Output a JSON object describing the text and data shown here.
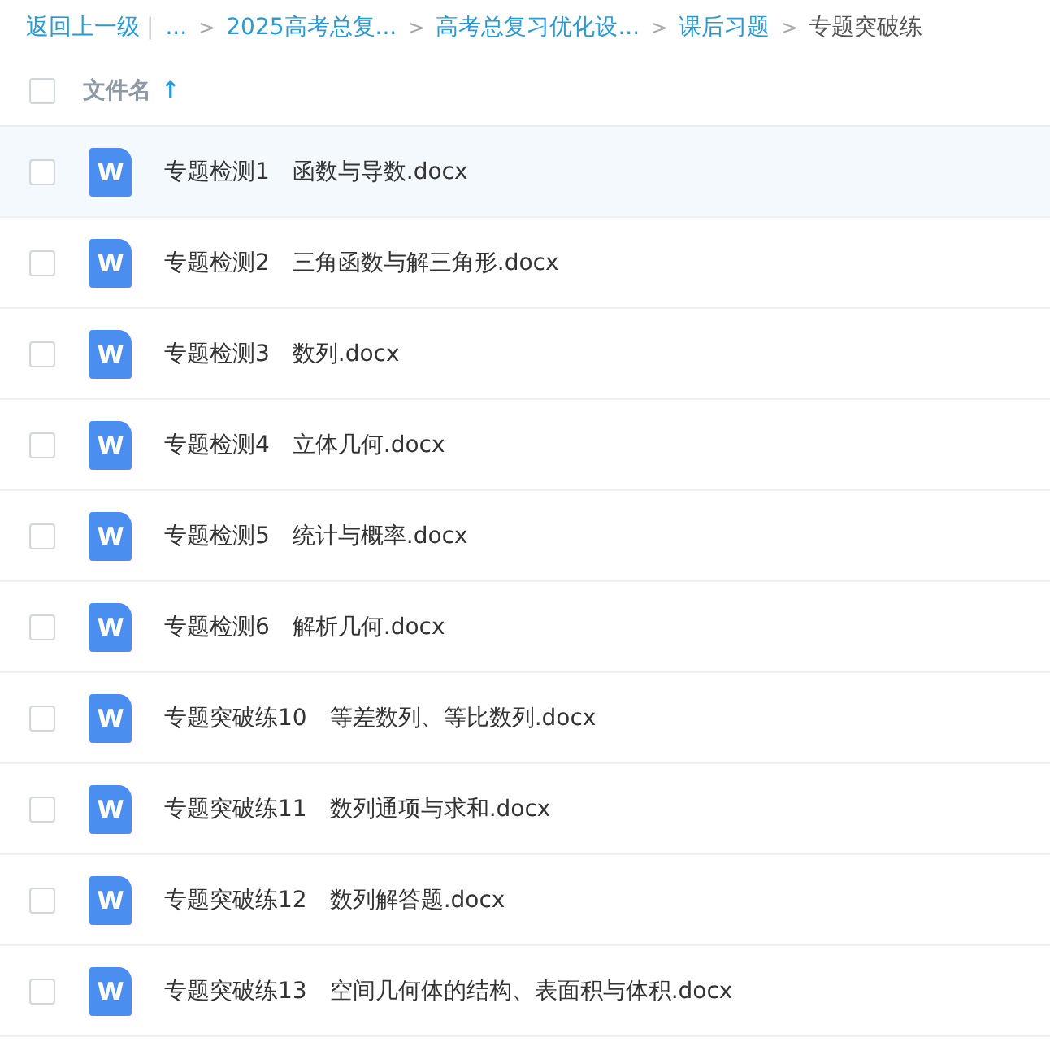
{
  "breadcrumb": {
    "back": "返回上一级",
    "divider": "|",
    "separator": ">",
    "items": [
      {
        "label": "...",
        "link": true
      },
      {
        "label": "2025高考总复...",
        "link": true
      },
      {
        "label": "高考总复习优化设...",
        "link": true
      },
      {
        "label": "课后习题",
        "link": true
      },
      {
        "label": "专题突破练",
        "link": false
      }
    ]
  },
  "table": {
    "header": {
      "checked": false,
      "label": "文件名",
      "sort_icon": "↑"
    },
    "rows": [
      {
        "name": "专题检测1　函数与导数.docx",
        "icon_letter": "W",
        "checked": false,
        "highlighted": true
      },
      {
        "name": "专题检测2　三角函数与解三角形.docx",
        "icon_letter": "W",
        "checked": false,
        "highlighted": false
      },
      {
        "name": "专题检测3　数列.docx",
        "icon_letter": "W",
        "checked": false,
        "highlighted": false
      },
      {
        "name": "专题检测4　立体几何.docx",
        "icon_letter": "W",
        "checked": false,
        "highlighted": false
      },
      {
        "name": "专题检测5　统计与概率.docx",
        "icon_letter": "W",
        "checked": false,
        "highlighted": false
      },
      {
        "name": "专题检测6　解析几何.docx",
        "icon_letter": "W",
        "checked": false,
        "highlighted": false
      },
      {
        "name": "专题突破练10　等差数列、等比数列.docx",
        "icon_letter": "W",
        "checked": false,
        "highlighted": false
      },
      {
        "name": "专题突破练11　数列通项与求和.docx",
        "icon_letter": "W",
        "checked": false,
        "highlighted": false
      },
      {
        "name": "专题突破练12　数列解答题.docx",
        "icon_letter": "W",
        "checked": false,
        "highlighted": false
      },
      {
        "name": "专题突破练13　空间几何体的结构、表面积与体积.docx",
        "icon_letter": "W",
        "checked": false,
        "highlighted": false
      }
    ]
  }
}
